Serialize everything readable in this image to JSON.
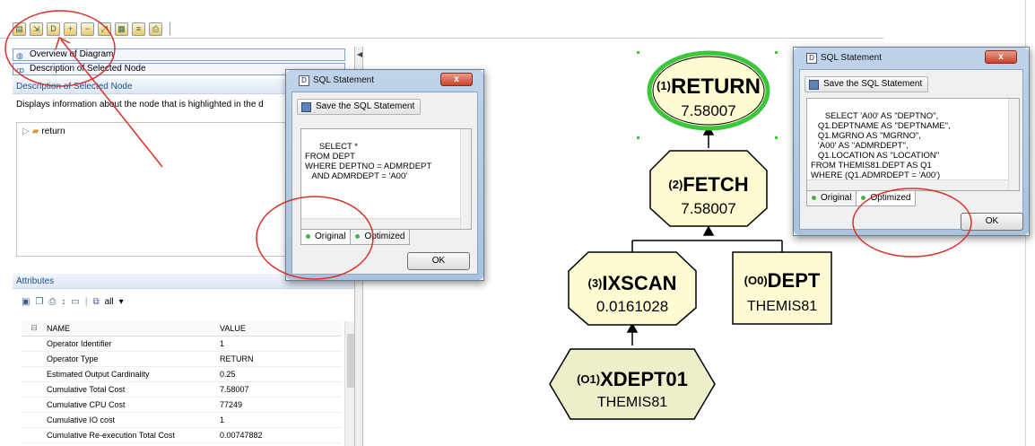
{
  "toolbar": {
    "icons": [
      "open-folder-icon",
      "export-icon",
      "document-icon",
      "zoom-in-icon",
      "zoom-out-icon",
      "fit-icon",
      "layout-icon",
      "tree-icon",
      "print-icon"
    ]
  },
  "left_panel": {
    "overview_label": "Overview of Diagram",
    "description_label": "Description of Selected Node",
    "description_header": "Description of Selected Node",
    "description_text": "Displays information about the node that is highlighted in the d",
    "tree_item": "return",
    "attributes_header": "Attributes",
    "filter_label": "all",
    "table_headers": {
      "name": "NAME",
      "value": "VALUE"
    },
    "rows": [
      {
        "name": "Operator Identifier",
        "value": "1"
      },
      {
        "name": "Operator Type",
        "value": "RETURN"
      },
      {
        "name": "Estimated Output Cardinality",
        "value": "0.25"
      },
      {
        "name": "Cumulative Total Cost",
        "value": "7.58007"
      },
      {
        "name": "Cumulative CPU Cost",
        "value": "77249"
      },
      {
        "name": "Cumulative IO cost",
        "value": "1"
      },
      {
        "name": "Cumulative Re-execution Total Cost",
        "value": "0.00747882"
      }
    ]
  },
  "dialog_original": {
    "title": "SQL Statement",
    "close_label": "x",
    "save_label": "Save the SQL Statement",
    "sql_text": "SELECT *\nFROM DEPT\nWHERE DEPTNO = ADMRDEPT\n   AND ADMRDEPT = 'A00'",
    "tab_original": "Original",
    "tab_optimized": "Optimized",
    "ok_label": "OK"
  },
  "dialog_optimized": {
    "title": "SQL Statement",
    "close_label": "x",
    "save_label": "Save the SQL Statement",
    "sql_text": "SELECT 'A00' AS \"DEPTNO\",\n   Q1.DEPTNAME AS \"DEPTNAME\",\n   Q1.MGRNO AS \"MGRNO\",\n   'A00' AS \"ADMRDEPT\",\n   Q1.LOCATION AS \"LOCATION\"\nFROM THEMIS81.DEPT AS Q1\nWHERE (Q1.ADMRDEPT = 'A00')",
    "tab_original": "Original",
    "tab_optimized": "Optimized",
    "ok_label": "OK"
  },
  "diagram": {
    "return_node": {
      "id": "(1)",
      "op": "RETURN",
      "cost": "7.58007"
    },
    "fetch_node": {
      "id": "(2)",
      "op": "FETCH",
      "cost": "7.58007"
    },
    "ixscan_node": {
      "id": "(3)",
      "op": "IXSCAN",
      "cost": "0.0161028"
    },
    "dept_node": {
      "id": "(O0)",
      "op": "DEPT",
      "cost": "THEMIS81"
    },
    "xdept01_node": {
      "id": "(O1)",
      "op": "XDEPT01",
      "cost": "THEMIS81"
    }
  },
  "colors": {
    "node_fill": "#fffbd2",
    "selection_ring": "#3cc63c",
    "annotation_red": "#d9302a",
    "xdept_fill": "#eeeecb"
  }
}
